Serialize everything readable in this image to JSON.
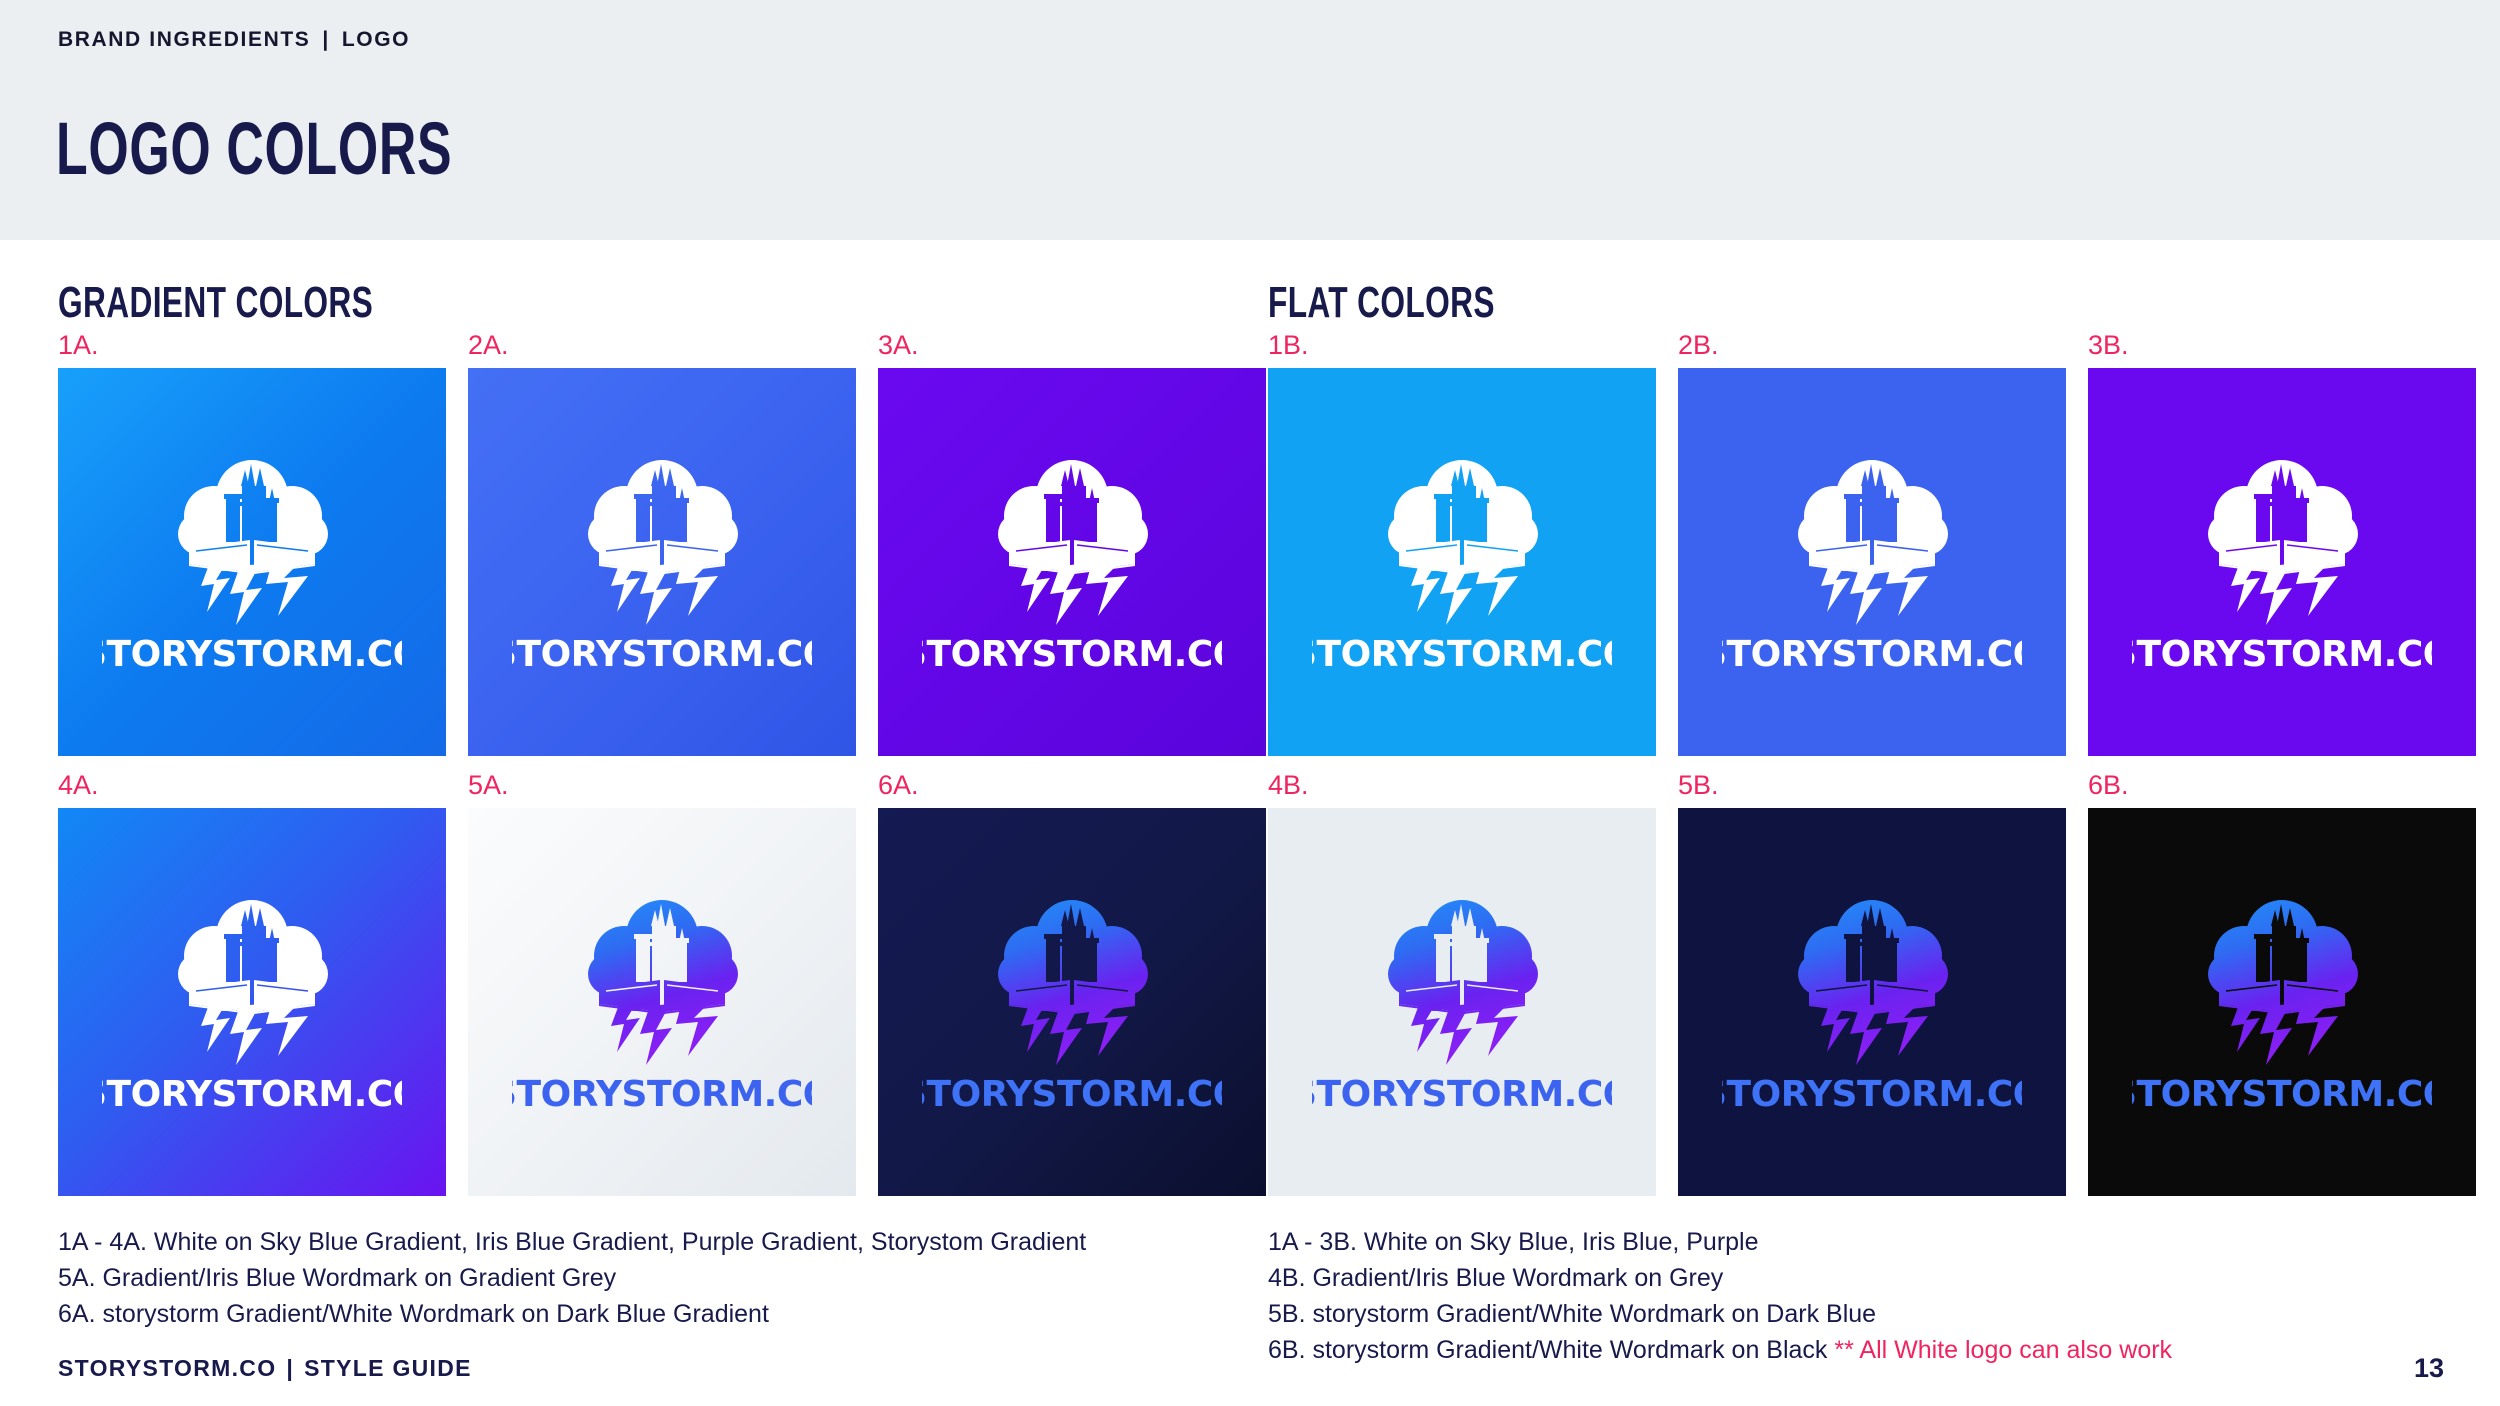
{
  "header": {
    "eyebrow_left": "BRAND INGREDIENTS",
    "eyebrow_sep": "|",
    "eyebrow_right": "LOGO",
    "title": "LOGO COLORS",
    "band_color": "#EBEFF2",
    "navy": "#171a4a",
    "accent_pink": "#f0245f"
  },
  "sections": [
    {
      "id": "gradient",
      "heading": "GRADIENT COLORS"
    },
    {
      "id": "flat",
      "heading": "FLAT COLORS"
    }
  ],
  "swatches": [
    {
      "label": "1A.",
      "name": "Sky Blue Gradient",
      "background": "linear-gradient(135deg, #18A0FB 0%, #0D7BF0 50%, #1569E8 100%)",
      "mark_style": "white",
      "wordmark_style": "white"
    },
    {
      "label": "2A.",
      "name": "Iris Blue Gradient",
      "background": "linear-gradient(135deg, #4470F5 0%, #3B63F0 50%, #2F55E6 100%)",
      "mark_style": "white",
      "wordmark_style": "white"
    },
    {
      "label": "3A.",
      "name": "Purple Gradient",
      "background": "linear-gradient(135deg, #6A09F0 0%, #6206E6 55%, #5A04DB 100%)",
      "mark_style": "white",
      "wordmark_style": "white"
    },
    {
      "label": "1B.",
      "name": "Sky Blue",
      "background": "#11A2F3",
      "mark_style": "white",
      "wordmark_style": "white"
    },
    {
      "label": "2B.",
      "name": "Iris Blue",
      "background": "#3B63F0",
      "mark_style": "white",
      "wordmark_style": "white"
    },
    {
      "label": "3B.",
      "name": "Purple",
      "background": "#6A09F0",
      "mark_style": "white",
      "wordmark_style": "white"
    },
    {
      "label": "4A.",
      "name": "Storystorm Gradient",
      "background": "linear-gradient(135deg, #1188F5 0%, #2F5CF0 45%, #6A13F0 100%)",
      "mark_style": "white",
      "wordmark_style": "white"
    },
    {
      "label": "5A.",
      "name": "Gradient Grey",
      "background": "linear-gradient(135deg, #FBFCFD 0%, #EFF2F5 55%, #E3E9EE 100%)",
      "mark_style": "gradient",
      "wordmark_style": "iris"
    },
    {
      "label": "6A.",
      "name": "Dark Blue Gradient",
      "background": "linear-gradient(135deg, #141A52 0%, #121846 55%, #0B0F2E 100%)",
      "mark_style": "gradient",
      "wordmark_style": "skyblue"
    },
    {
      "label": "4B.",
      "name": "Grey",
      "background": "#E8EDF1",
      "mark_style": "gradient",
      "wordmark_style": "iris"
    },
    {
      "label": "5B.",
      "name": "Dark Blue",
      "background": "#0E1340",
      "mark_style": "gradient",
      "wordmark_style": "skyblue"
    },
    {
      "label": "6B.",
      "name": "Black",
      "background": "#0A0A0A",
      "mark_style": "gradient",
      "wordmark_style": "skyblue"
    }
  ],
  "wordmark_text": "STORYSTORM.CO",
  "captions": {
    "left": [
      "1A - 4A. White on Sky Blue Gradient, Iris Blue Gradient, Purple Gradient, Storystom Gradient",
      "5A. Gradient/Iris Blue Wordmark on Gradient Grey",
      "6A. storystorm Gradient/White Wordmark on Dark Blue Gradient"
    ],
    "right": [
      "1A - 3B. White on Sky Blue, Iris Blue, Purple",
      "4B. Gradient/Iris Blue Wordmark on Grey",
      "5B. storystorm Gradient/White Wordmark on Dark Blue"
    ],
    "right_last_main": "6B. storystorm Gradient/White Wordmark on Black ",
    "right_last_note": "** All White logo can also work"
  },
  "footer": {
    "brand": "STORYSTORM.CO",
    "sep": "|",
    "label": "STYLE GUIDE",
    "page_number": "13"
  }
}
